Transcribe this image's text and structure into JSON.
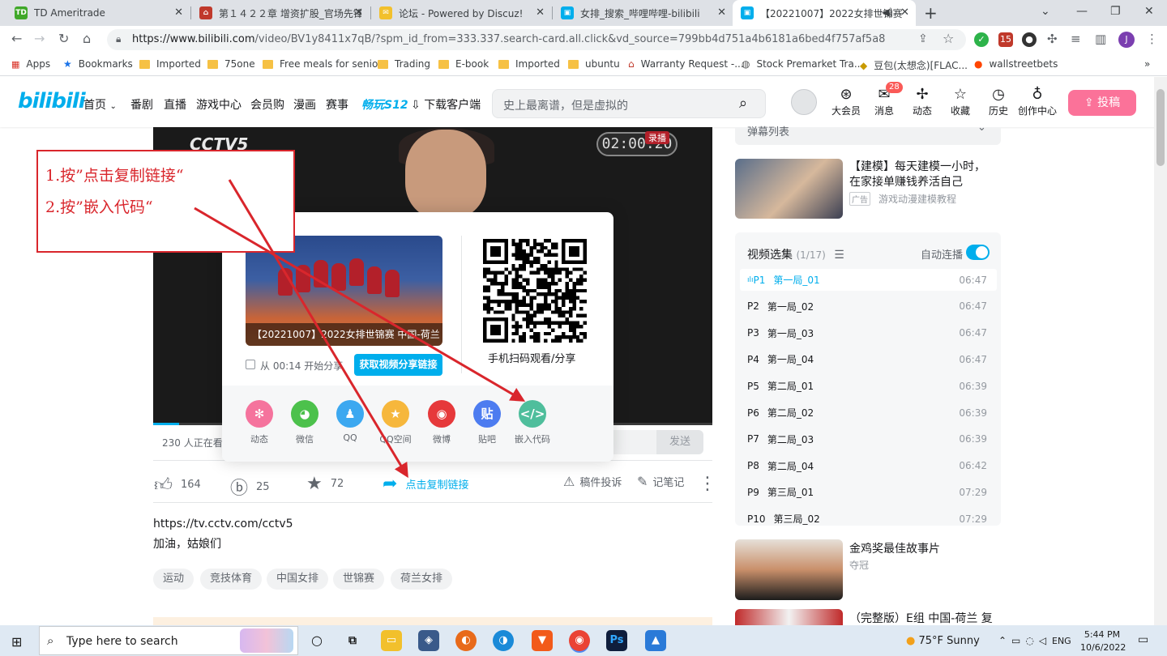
{
  "browser": {
    "tabs": [
      {
        "title": "TD Ameritrade",
        "favicon": "TD"
      },
      {
        "title": "第１４２２章 增资扩股_官场先锋",
        "favicon": "home-icon"
      },
      {
        "title": "论坛 - Powered by Discuz!",
        "favicon": "discuz-icon"
      },
      {
        "title": "女排_搜索_哔哩哔哩-bilibili",
        "favicon": "bilibili-icon"
      },
      {
        "title": "【20221007】2022女排世锦赛",
        "favicon": "bilibili-icon"
      }
    ],
    "url_host": "https://www.bilibili.com",
    "url_path": "/video/BV1y8411x7qB/?spm_id_from=333.337.search-card.all.click&vd_source=799bb4d751a4b6181a6bed4f757af5a8",
    "ext_badge": "15",
    "profile_initial": "J",
    "bookmarks": [
      "Apps",
      "Bookmarks",
      "Imported",
      "75one",
      "Free meals for senior",
      "Trading",
      "E-book",
      "Imported",
      "ubuntu",
      "Warranty Request -...",
      "Stock Premarket Tra...",
      "豆包(太想念)[FLAC...",
      "wallstreetbets"
    ]
  },
  "header": {
    "logo": "bilibili",
    "nav": [
      "首页",
      "番剧",
      "直播",
      "游戏中心",
      "会员购",
      "漫画",
      "赛事",
      "畅玩S12",
      "下载客户端"
    ],
    "search_placeholder": "史上最离谱，但是虚拟的",
    "icons": [
      {
        "label": "大会员",
        "icon": "vip-icon"
      },
      {
        "label": "消息",
        "icon": "message-icon"
      },
      {
        "label": "动态",
        "icon": "dynamic-icon"
      },
      {
        "label": "收藏",
        "icon": "favorite-icon"
      },
      {
        "label": "历史",
        "icon": "history-icon"
      },
      {
        "label": "创作中心",
        "icon": "creator-icon"
      }
    ],
    "message_badge": "28",
    "upload": "投稿"
  },
  "video": {
    "channel_logo": "CCTV5",
    "score_time": "02:00:20",
    "score_tag": "录播",
    "viewers": "230 人正在看",
    "send": "发送",
    "progress": 0.046
  },
  "share": {
    "thumb_caption": "【20221007】2022女排世锦赛 中国-荷兰",
    "start_from": "从 00:14 开始分享",
    "get_link": "获取视频分享链接",
    "qr_caption": "手机扫码观看/分享",
    "targets": [
      {
        "label": "动态",
        "color": "#f5739d",
        "glyph": "✻"
      },
      {
        "label": "微信",
        "color": "#4cc14c",
        "glyph": "◕"
      },
      {
        "label": "QQ",
        "color": "#3ca8f0",
        "glyph": "♟"
      },
      {
        "label": "QQ空间",
        "color": "#f6b73c",
        "glyph": "★"
      },
      {
        "label": "微博",
        "color": "#e6393b",
        "glyph": "◉"
      },
      {
        "label": "贴吧",
        "color": "#4d7cf0",
        "glyph": "贴"
      },
      {
        "label": "嵌入代码",
        "color": "#4fbe9c",
        "glyph": "</>"
      }
    ]
  },
  "actions": {
    "likes": "164",
    "coins": "25",
    "favorites": "72",
    "share_label": "点击复制链接",
    "report": "稿件投诉",
    "notes": "记笔记"
  },
  "description": {
    "line1": "https://tv.cctv.com/cctv5",
    "line2": "加油，姑娘们",
    "tags": [
      "运动",
      "竞技体育",
      "中国女排",
      "世锦赛",
      "荷兰女排"
    ]
  },
  "sidebar": {
    "danmaku_list": "弹幕列表",
    "ad": {
      "title": "【建模】每天建模一小时，在家接单赚钱养活自己",
      "tag": "广告",
      "sub": "游戏动漫建模教程"
    },
    "playlist": {
      "title": "视频选集",
      "count": "(1/17)",
      "autoplay": "自动连播",
      "items": [
        {
          "p": "P1",
          "name": "第一局_01",
          "dur": "06:47"
        },
        {
          "p": "P2",
          "name": "第一局_02",
          "dur": "06:47"
        },
        {
          "p": "P3",
          "name": "第一局_03",
          "dur": "06:47"
        },
        {
          "p": "P4",
          "name": "第一局_04",
          "dur": "06:47"
        },
        {
          "p": "P5",
          "name": "第二局_01",
          "dur": "06:39"
        },
        {
          "p": "P6",
          "name": "第二局_02",
          "dur": "06:39"
        },
        {
          "p": "P7",
          "name": "第二局_03",
          "dur": "06:39"
        },
        {
          "p": "P8",
          "name": "第二局_04",
          "dur": "06:42"
        },
        {
          "p": "P9",
          "name": "第三局_01",
          "dur": "07:29"
        },
        {
          "p": "P10",
          "name": "第三局_02",
          "dur": "07:29"
        }
      ]
    },
    "rec1": {
      "title": "金鸡奖最佳故事片",
      "sub": "夺冠"
    },
    "rec2": {
      "title": "（完整版）E组 中国-荷兰 复"
    }
  },
  "annotation": {
    "line1": "1.按”点击复制链接“",
    "line2": "2.按”嵌入代码“",
    "color": "#d9262c"
  },
  "taskbar": {
    "search": "Type here to search",
    "weather": "75°F  Sunny",
    "lang": "ENG",
    "time": "5:44 PM",
    "date": "10/6/2022"
  }
}
